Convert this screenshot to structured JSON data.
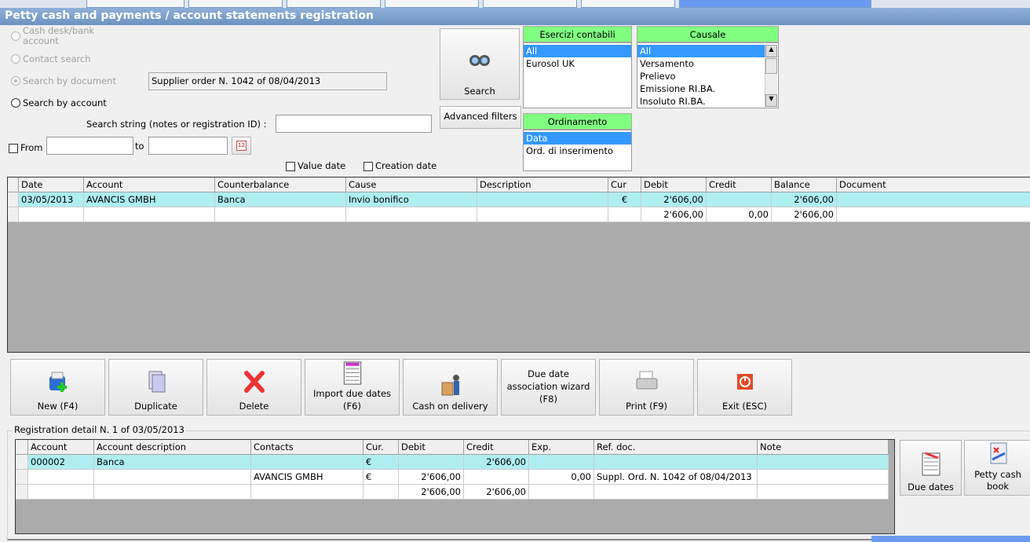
{
  "window": {
    "title": "Petty cash and payments / account statements registration"
  },
  "search": {
    "radios": [
      {
        "label": "Cash desk/bank account",
        "state": "disabled"
      },
      {
        "label": "Contact search",
        "state": "disabled"
      },
      {
        "label": "Search by document",
        "state": "disabled-checked"
      },
      {
        "label": "Search by account",
        "state": "enabled"
      }
    ],
    "document_value": "Supplier order N. 1042 of 08/04/2013",
    "search_string_label": "Search string (notes or registration ID) :",
    "search_string_value": "",
    "from_label": "From",
    "to_label": "to",
    "from_value": "",
    "to_value": "",
    "value_date_label": "Value date",
    "creation_date_label": "Creation date",
    "search_button": "Search",
    "advanced_filters_button": "Advanced filters"
  },
  "filters": {
    "esercizi": {
      "title": "Esercizi contabili",
      "items": [
        "All",
        "Eurosol UK"
      ],
      "selected": 0
    },
    "causale": {
      "title": "Causale",
      "items": [
        "All",
        "Versamento",
        "Prelievo",
        "Emissione RI.BA.",
        "Insoluto RI.BA."
      ],
      "selected": 0
    },
    "ordinamento": {
      "title": "Ordinamento",
      "items": [
        "Data",
        "Ord. di inserimento"
      ],
      "selected": 0
    }
  },
  "main_grid": {
    "columns": [
      "Date",
      "Account",
      "Counterbalance",
      "Cause",
      "Description",
      "Cur",
      "Debit",
      "Credit",
      "Balance",
      "Document"
    ],
    "rows": [
      [
        "03/05/2013",
        "AVANCIS GMBH",
        "Banca",
        "Invio bonifico",
        "",
        "€",
        "2'606,00",
        "",
        "2'606,00",
        ""
      ],
      [
        "",
        "",
        "",
        "",
        "",
        "",
        "2'606,00",
        "0,00",
        "2'606,00",
        ""
      ]
    ]
  },
  "toolbar": [
    {
      "label": "New (F4)",
      "icon": "new-icon"
    },
    {
      "label": "Duplicate",
      "icon": "duplicate-icon"
    },
    {
      "label": "Delete",
      "icon": "delete-icon"
    },
    {
      "label": "Import due dates (F6)",
      "icon": "import-icon"
    },
    {
      "label": "Cash on delivery",
      "icon": "delivery-icon"
    },
    {
      "label": "Due date association wizard (F8)",
      "icon": ""
    },
    {
      "label": "Print (F9)",
      "icon": "print-icon"
    },
    {
      "label": "Exit (ESC)",
      "icon": "exit-icon"
    }
  ],
  "detail": {
    "legend": "Registration detail N. 1 of 03/05/2013",
    "columns": [
      "Account",
      "Account description",
      "Contacts",
      "Cur.",
      "Debit",
      "Credit",
      "Exp.",
      "Ref. doc.",
      "Note"
    ],
    "rows": [
      [
        "000002",
        "Banca",
        "",
        "€",
        "",
        "2'606,00",
        "",
        "",
        ""
      ],
      [
        "",
        "",
        "AVANCIS GMBH",
        "€",
        "2'606,00",
        "",
        "0,00",
        "Suppl. Ord. N. 1042 of 08/04/2013",
        ""
      ],
      [
        "",
        "",
        "",
        "",
        "2'606,00",
        "2'606,00",
        "",
        "",
        ""
      ]
    ],
    "due_dates_button": "Due dates",
    "petty_cash_book_button": "Petty cash book"
  },
  "colors": {
    "highlight": "#aeeef0",
    "selection": "#3399ff",
    "panel_header": "#80ff80"
  }
}
